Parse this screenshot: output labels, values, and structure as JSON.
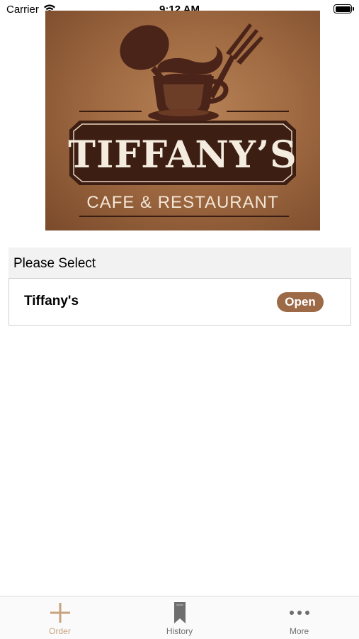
{
  "status_bar": {
    "carrier": "Carrier",
    "time": "9:12 AM"
  },
  "logo": {
    "name": "TIFFANY’S",
    "subtitle": "CAFE & RESTAURANT"
  },
  "section": {
    "title": "Please Select"
  },
  "locations": [
    {
      "name": "Tiffany's",
      "status": "Open"
    }
  ],
  "tabs": [
    {
      "label": "Order",
      "icon": "plus-icon",
      "active": true
    },
    {
      "label": "History",
      "icon": "bookmark-icon",
      "active": false
    },
    {
      "label": "More",
      "icon": "ellipsis-icon",
      "active": false
    }
  ],
  "colors": {
    "accent": "#c8a27f",
    "inactive": "#6e6e6e",
    "badge": "#9c6a46"
  }
}
